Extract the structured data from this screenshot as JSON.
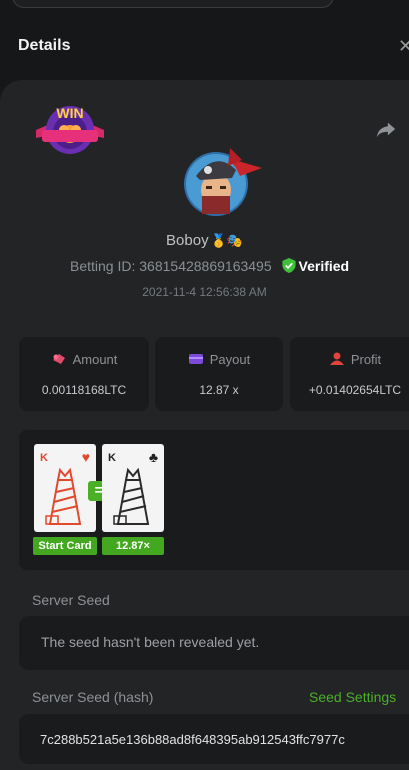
{
  "header": {
    "title": "Details"
  },
  "bet": {
    "username": "Boboy",
    "betting_id_label": "Betting ID:",
    "betting_id": "36815428869163495",
    "verified_label": "Verified",
    "timestamp": "2021-11-4 12:56:38 AM",
    "result_badge": "WIN"
  },
  "stats": {
    "amount": {
      "label": "Amount",
      "value": "0.00118168LTC"
    },
    "payout": {
      "label": "Payout",
      "value": "12.87 x"
    },
    "profit": {
      "label": "Profit",
      "value": "+0.01402654LTC"
    }
  },
  "game": {
    "start_card": {
      "rank": "K",
      "suit": "♥",
      "label": "Start Card"
    },
    "result_card": {
      "rank": "K",
      "suit": "♣",
      "label": "12.87×"
    },
    "equals": "="
  },
  "server_seed": {
    "label": "Server Seed",
    "value": "The seed hasn't been revealed yet."
  },
  "server_seed_hash": {
    "label": "Server Seed (hash)",
    "settings_link": "Seed Settings",
    "value": "7c288b521a5e136b88ad8f648395ab912543ffc7977c"
  },
  "colors": {
    "accent_green": "#4caf28",
    "panel": "#222426",
    "card_red": "#e24a2e"
  },
  "icons": [
    "close-icon",
    "win-badge",
    "share-icon",
    "avatar",
    "verified-shield-icon",
    "amount-icon",
    "payout-icon",
    "profit-icon"
  ]
}
